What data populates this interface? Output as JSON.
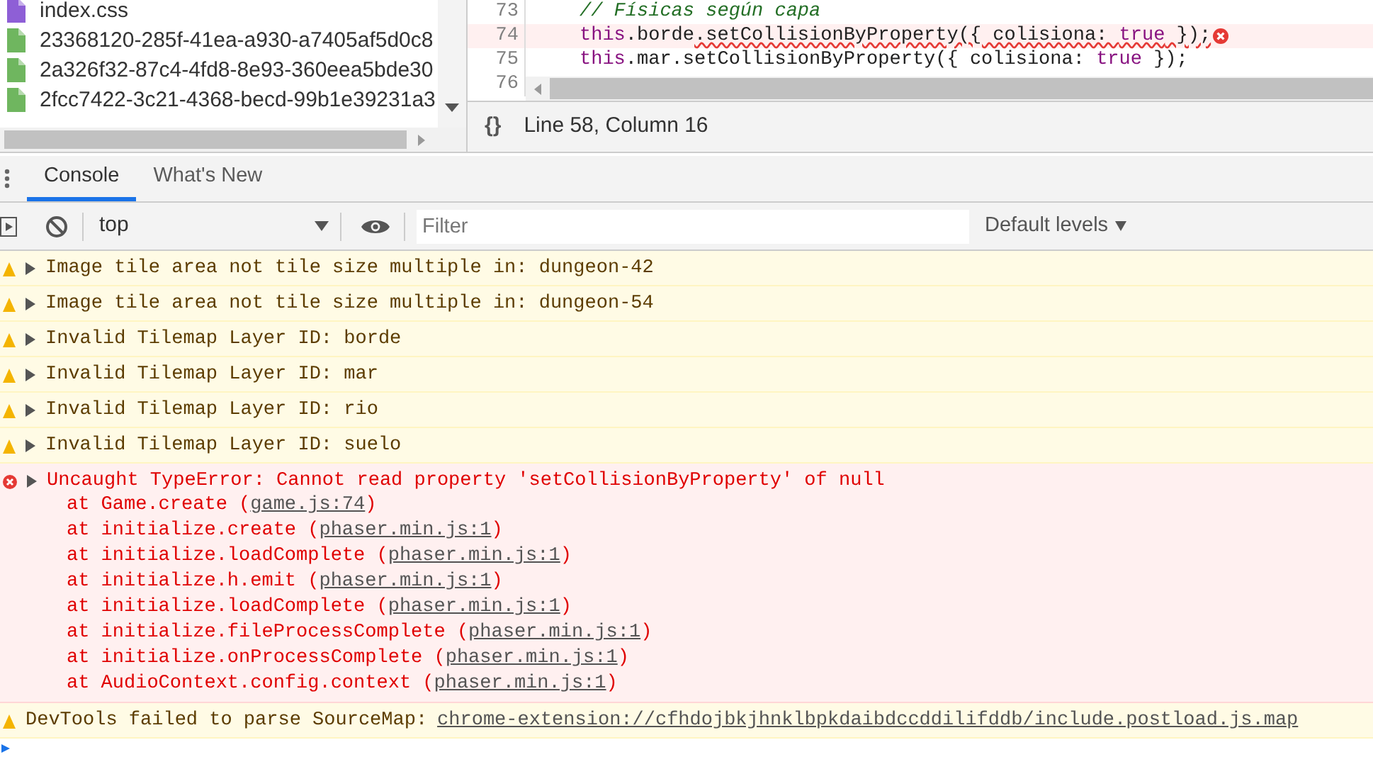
{
  "files": [
    {
      "name": "index.css",
      "kind": "css"
    },
    {
      "name": "23368120-285f-41ea-a930-a7405af5d0c8",
      "kind": "script"
    },
    {
      "name": "2a326f32-87c4-4fd8-8e93-360eea5bde30",
      "kind": "script"
    },
    {
      "name": "2fcc7422-3c21-4368-becd-99b1e39231a3",
      "kind": "script"
    }
  ],
  "editor": {
    "lines": [
      {
        "number": "73",
        "error": false,
        "tokens": [
          {
            "text": "// Físicas según capa",
            "kind": "comment",
            "flagged": false
          }
        ]
      },
      {
        "number": "74",
        "error": true,
        "tokens": [
          {
            "text": "this",
            "kind": "keyword",
            "flagged": false
          },
          {
            "text": ".borde",
            "kind": "plain",
            "flagged": false
          },
          {
            "text": ".setCollisionByProperty({ colisiona: ",
            "kind": "plain",
            "flagged": true
          },
          {
            "text": "true",
            "kind": "keyword",
            "flagged": true
          },
          {
            "text": " });",
            "kind": "plain",
            "flagged": true
          }
        ]
      },
      {
        "number": "75",
        "error": false,
        "tokens": [
          {
            "text": "this",
            "kind": "keyword",
            "flagged": false
          },
          {
            "text": ".mar.setCollisionByProperty({ colisiona: ",
            "kind": "plain",
            "flagged": false
          },
          {
            "text": "true",
            "kind": "keyword",
            "flagged": false
          },
          {
            "text": " });",
            "kind": "plain",
            "flagged": false
          }
        ]
      },
      {
        "number": "76",
        "error": false
      }
    ],
    "status": {
      "format_button": "{}",
      "cursor": "Line 58, Column 16"
    }
  },
  "drawer_tabs": [
    {
      "label": "Console",
      "selected": true
    },
    {
      "label": "What's New",
      "selected": false
    }
  ],
  "toolbar": {
    "context": "top",
    "filter": {
      "placeholder": "Filter"
    },
    "levels": "Default levels"
  },
  "messages": [
    {
      "kind": "warning",
      "text": "Image tile area not tile size multiple in: dungeon-42",
      "expandable": true
    },
    {
      "kind": "warning",
      "text": "Image tile area not tile size multiple in: dungeon-54",
      "expandable": true
    },
    {
      "kind": "warning",
      "text": "Invalid Tilemap Layer ID: borde",
      "expandable": true
    },
    {
      "kind": "warning",
      "text": "Invalid Tilemap Layer ID: mar",
      "expandable": true
    },
    {
      "kind": "warning",
      "text": "Invalid Tilemap Layer ID: rio",
      "expandable": true
    },
    {
      "kind": "warning",
      "text": "Invalid Tilemap Layer ID: suelo",
      "expandable": true
    },
    {
      "kind": "error",
      "text": "Uncaught TypeError: Cannot read property 'setCollisionByProperty' of null",
      "expandable": true,
      "stack": [
        {
          "text": "at Game.create (",
          "link": "game.js:74",
          "suffix": ")"
        },
        {
          "text": "at initialize.create (",
          "link": "phaser.min.js:1",
          "suffix": ")"
        },
        {
          "text": "at initialize.loadComplete (",
          "link": "phaser.min.js:1",
          "suffix": ")"
        },
        {
          "text": "at initialize.h.emit (",
          "link": "phaser.min.js:1",
          "suffix": ")"
        },
        {
          "text": "at initialize.loadComplete (",
          "link": "phaser.min.js:1",
          "suffix": ")"
        },
        {
          "text": "at initialize.fileProcessComplete (",
          "link": "phaser.min.js:1",
          "suffix": ")"
        },
        {
          "text": "at initialize.onProcessComplete (",
          "link": "phaser.min.js:1",
          "suffix": ")"
        },
        {
          "text": "at AudioContext.config.context (",
          "link": "phaser.min.js:1",
          "suffix": ")"
        }
      ]
    },
    {
      "kind": "warning",
      "text": "DevTools failed to parse SourceMap:",
      "expandable": false,
      "link": "chrome-extension://cfhdojbkjhnklbpkdaibdccddilifddb/include.postload.js.map"
    }
  ]
}
